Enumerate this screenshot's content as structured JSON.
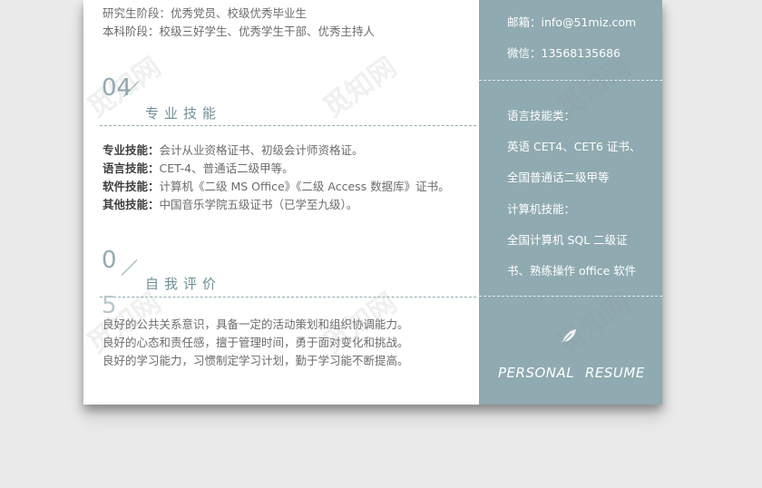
{
  "education_lines": [
    "研究生阶段：优秀党员、校级优秀毕业生",
    "本科阶段：校级三好学生、优秀学生干部、优秀主持人"
  ],
  "contact": {
    "email": "邮箱：info@51miz.com",
    "wechat": "微信：13568135686"
  },
  "section_skills": {
    "number": "04",
    "title": "专业技能",
    "items": [
      {
        "label": "专业技能：",
        "value": "会计从业资格证书、初级会计师资格证。"
      },
      {
        "label": "语言技能：",
        "value": "CET-4、普通话二级甲等。"
      },
      {
        "label": "软件技能：",
        "value": "计算机《二级 MS Office》《二级 Access 数据库》证书。"
      },
      {
        "label": "其他技能：",
        "value": "中国音乐学院五级证书（已学至九级）。"
      }
    ]
  },
  "section_self": {
    "number_top": "0",
    "number_bottom": "5",
    "title": "自我评价",
    "lines": [
      "良好的公共关系意识，具备一定的活动策划和组织协调能力。",
      "良好的心态和责任感，擅于管理时间，勇于面对变化和挑战。",
      "良好的学习能力，习惯制定学习计划，勤于学习能不断提高。"
    ]
  },
  "sidebar_skills": [
    "语言技能类：",
    "英语 CET4、CET6 证书、",
    "全国普通话二级甲等",
    "计算机技能：",
    "全国计算机 SQL 二级证",
    "书、熟练操作 office 软件"
  ],
  "footer": {
    "word1": "PERSONAL",
    "word2": "RESUME",
    "icon": "feather-icon"
  },
  "watermark": "觅知网",
  "colors": {
    "accent": "#93aab1",
    "sidebar": "#8faab0"
  }
}
